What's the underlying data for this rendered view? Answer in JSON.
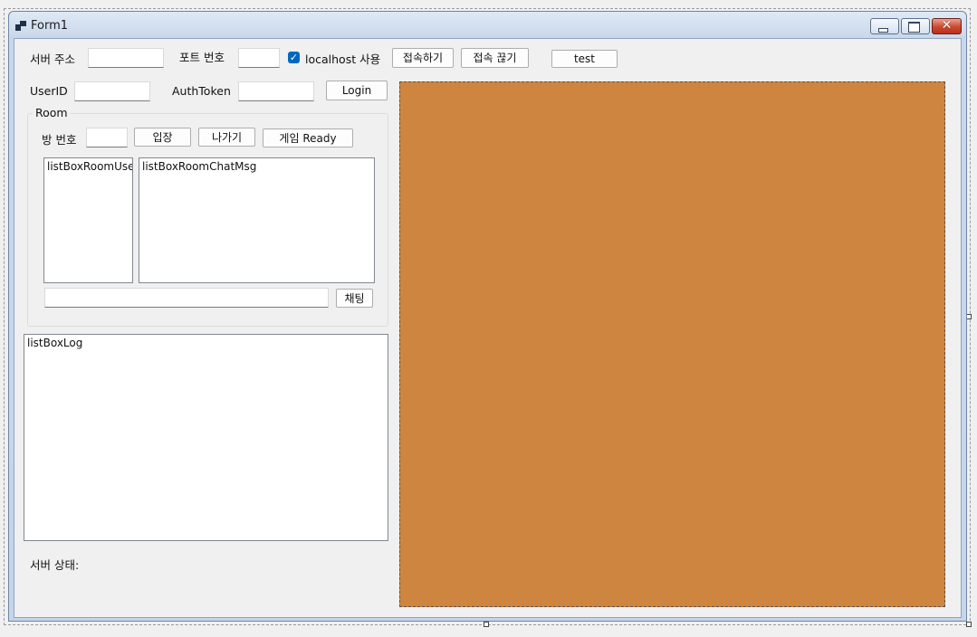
{
  "window": {
    "title": "Form1"
  },
  "controls": {
    "server_address_label": "서버 주소",
    "server_address_value": "",
    "port_label": "포트 번호",
    "port_value": "",
    "localhost_checkbox_label": "localhost 사용",
    "localhost_checked": true,
    "connect_button": "접속하기",
    "disconnect_button": "접속 끊기",
    "test_button": "test",
    "userid_label": "UserID",
    "userid_value": "",
    "authtoken_label": "AuthToken",
    "authtoken_value": "",
    "login_button": "Login"
  },
  "room": {
    "group_title": "Room",
    "room_number_label": "방 번호",
    "room_number_value": "",
    "enter_button": "입장",
    "leave_button": "나가기",
    "ready_button": "게임 Ready",
    "user_list": [
      "listBoxRoomUserList"
    ],
    "chat_list": [
      "listBoxRoomChatMsg"
    ],
    "chat_input_value": "",
    "chat_button": "채팅"
  },
  "log": {
    "items": [
      "listBoxLog"
    ]
  },
  "status": {
    "server_state_label": "서버 상태:"
  },
  "colors": {
    "picture_background": "#cd853f",
    "checkbox_accent": "#0067c0",
    "close_button": "#c9492f"
  },
  "icons": {
    "app": "form-icon",
    "minimize": "minimize-icon",
    "maximize": "maximize-icon",
    "close": "close-icon",
    "checkbox": "checkmark-icon"
  }
}
